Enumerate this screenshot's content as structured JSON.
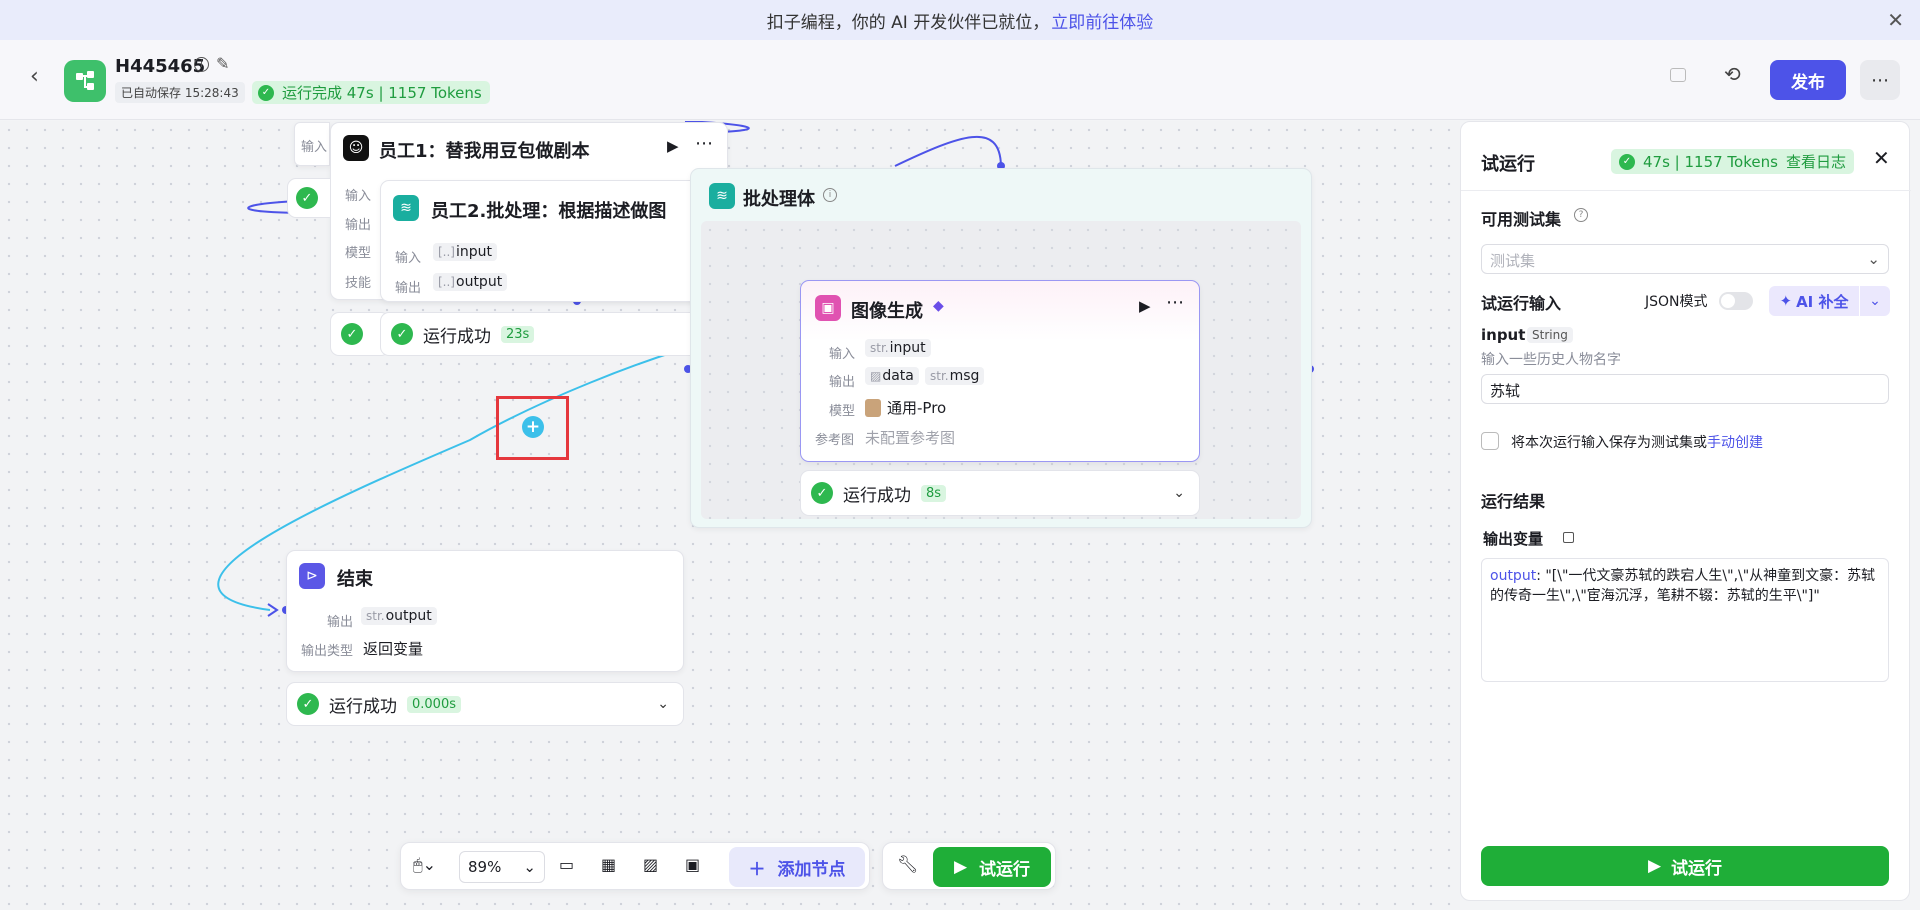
{
  "banner": {
    "text": "扣子编程，你的 AI 开发伙伴已就位，",
    "link": "立即前往体验"
  },
  "header": {
    "title": "H445465",
    "autosave": "已自动保存 15:28:43",
    "run_status": "运行完成 47s | 1157 Tokens",
    "publish": "发布"
  },
  "nodes": {
    "emp1": {
      "title": "员工1：替我用豆包做剧本",
      "labels": [
        "输入",
        "输出",
        "模型",
        "技能"
      ],
      "top_label": "输入"
    },
    "emp2": {
      "title": "员工2.批处理：根据描述做图",
      "in_label": "输入",
      "out_label": "输出",
      "in": "input",
      "out": "output"
    },
    "run_ok": "运行成功",
    "t_emp2": "23s",
    "t_img": "8s",
    "t_end": "0.000s",
    "batch": {
      "title": "批处理体"
    },
    "image": {
      "title": "图像生成",
      "in_label": "输入",
      "out_label": "输出",
      "model_label": "模型",
      "ref_label": "参考图",
      "in": "input",
      "out1": "data",
      "out2": "msg",
      "model": "通用-Pro",
      "ref": "未配置参考图"
    },
    "end": {
      "title": "结束",
      "out_label": "输出",
      "type_label": "输出类型",
      "out": "output",
      "type": "返回变量"
    },
    "str": "str."
  },
  "toolbar": {
    "zoom": "89%",
    "add_node": "添加节点",
    "run": "试运行"
  },
  "panel": {
    "title": "试运行",
    "stats": "47s | 1157 Tokens",
    "log": "查看日志",
    "testset_label": "可用测试集",
    "testset_placeholder": "测试集",
    "input_title": "试运行输入",
    "json_mode": "JSON模式",
    "ai_fill": "AI 补全",
    "var_name": "input",
    "var_type": "String",
    "var_desc": "输入一些历史人物名字",
    "var_value": "苏轼",
    "save_text": "将本次运行输入保存为测试集或",
    "manual": "手动创建",
    "result_title": "运行结果",
    "output_var": "输出变量",
    "output_key": "output",
    "output_val": ": \"[\\\"一代文豪苏轼的跌宕人生\\\",\\\"从神童到文豪：苏轼的传奇一生\\\",\\\"宦海沉浮，笔耕不辍：苏轼的生平\\\"]\"",
    "run_btn": "试运行"
  },
  "colors": {
    "accent": "#4d53e8",
    "success": "#2eb84f",
    "run_btn": "#1fae38"
  }
}
